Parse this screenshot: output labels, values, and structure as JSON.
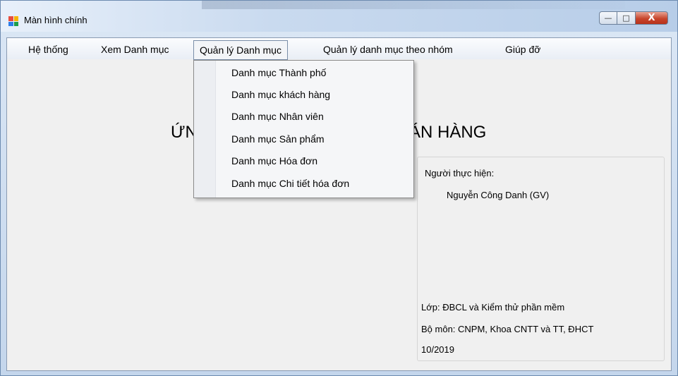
{
  "window": {
    "title": "Màn hình chính",
    "controls": {
      "minimize": "—",
      "maximize": "□",
      "close": "X"
    }
  },
  "menubar": {
    "items": [
      "Hệ thống",
      "Xem Danh mục",
      "Quản lý Danh mục",
      "Quản lý danh mục theo nhóm",
      "Giúp đỡ"
    ]
  },
  "dropdown": {
    "items": [
      "Danh mục Thành phố",
      "Danh mục khách hàng",
      "Danh mục Nhân viên",
      "Danh mục Sản phẩm",
      "Danh mục Hóa đơn",
      "Danh mục Chi tiết hóa đơn"
    ]
  },
  "main": {
    "heading_left": "ỨN",
    "heading_right": "ÁN HÀNG"
  },
  "info": {
    "performer_label": "Người thực hiện:",
    "performer_name": "Nguyễn Công Danh (GV)",
    "class": "Lớp: ĐBCL và Kiểm thử phần mềm",
    "department": "Bộ môn: CNPM, Khoa CNTT và TT, ĐHCT",
    "date": "10/2019"
  },
  "colors": {
    "close_button": "#c7452d",
    "client_bg": "#f0f0f0",
    "menu_bg": "#f5f6f8"
  }
}
